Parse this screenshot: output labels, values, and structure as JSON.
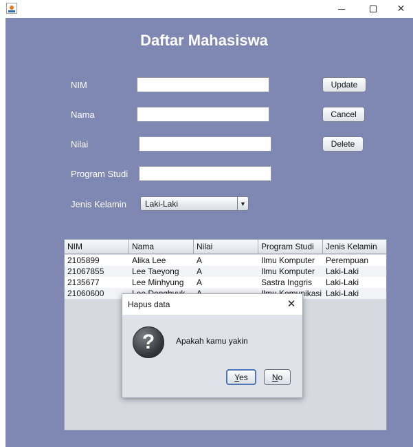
{
  "window": {
    "title": "",
    "icon": "java-cup-icon"
  },
  "page": {
    "title": "Daftar Mahasiswa",
    "background_color": "#7f87b3"
  },
  "form": {
    "labels": {
      "nim": "NIM",
      "nama": "Nama",
      "nilai": "Nilai",
      "program_studi": "Program Studi",
      "jenis_kelamin": "Jenis Kelamin"
    },
    "values": {
      "nim": "",
      "nama": "",
      "nilai": "",
      "program_studi": ""
    },
    "jenis_kelamin_selected": "Laki-Laki"
  },
  "buttons": {
    "update": "Update",
    "cancel": "Cancel",
    "delete": "Delete"
  },
  "table": {
    "columns": [
      "NIM",
      "Nama",
      "Nilai",
      "Program Studi",
      "Jenis Kelamin"
    ],
    "rows": [
      [
        "2105899",
        "Alika Lee",
        "A",
        "Ilmu Komputer",
        "Perempuan"
      ],
      [
        "21067855",
        "Lee Taeyong",
        "A",
        "Ilmu Komputer",
        "Laki-Laki"
      ],
      [
        "2135677",
        "Lee Minhyung",
        "A",
        "Sastra Inggris",
        "Laki-Laki"
      ],
      [
        "21060600",
        "Lee Donghyuk",
        "A",
        "Ilmu Komunikasi",
        "Laki-Laki"
      ]
    ]
  },
  "dialog": {
    "title": "Hapus data",
    "icon": "question-icon",
    "message": "Apakah kamu yakin",
    "yes": "Yes",
    "no": "No"
  }
}
